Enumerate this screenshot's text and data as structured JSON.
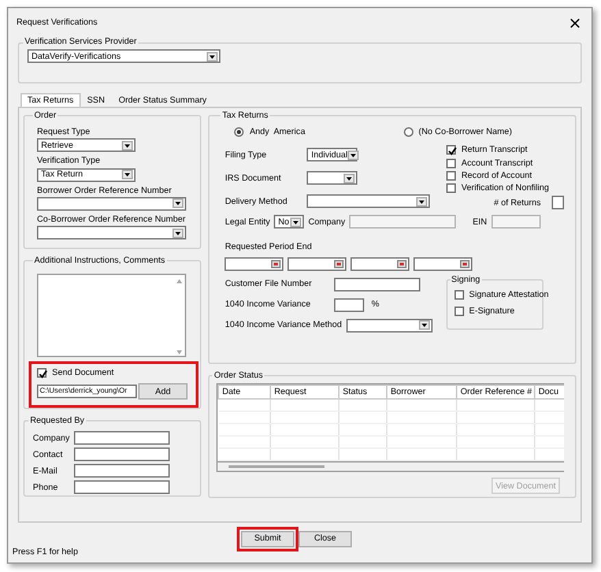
{
  "window": {
    "title": "Request Verifications"
  },
  "provider": {
    "label": "Verification Services Provider",
    "value": "DataVerify-Verifications"
  },
  "tabs": [
    {
      "label": "Tax Returns",
      "selected": true
    },
    {
      "label": "SSN",
      "selected": false
    },
    {
      "label": "Order Status Summary",
      "selected": false
    }
  ],
  "order": {
    "title": "Order",
    "fields": [
      {
        "label": "Request Type",
        "value": "Retrieve"
      },
      {
        "label": "Verification Type",
        "value": "Tax Return"
      },
      {
        "label": "Borrower Order Reference Number"
      },
      {
        "label": "Co-Borrower Order Reference Number"
      }
    ]
  },
  "instructions": {
    "title": "Additional Instructions, Comments",
    "highlighted": true,
    "send_document": {
      "label": "Send Document",
      "checked": true
    },
    "path": "C:\\Users\\derrick_young\\Or",
    "add_button": "Add"
  },
  "requested_by": {
    "title": "Requested By",
    "fields": [
      "Company",
      "Contact",
      "E-Mail",
      "Phone"
    ]
  },
  "tax_returns": {
    "title": "Tax Returns",
    "borrowers": [
      {
        "label": "Andy  America",
        "selected": true
      },
      {
        "label": "(No Co-Borrower Name)",
        "selected": false
      }
    ],
    "filing_type": {
      "label": "Filing Type",
      "value": "Individual"
    },
    "irs_document": {
      "label": "IRS Document"
    },
    "delivery_method": {
      "label": "Delivery Method"
    },
    "options": [
      {
        "label": "Return Transcript",
        "checked": true
      },
      {
        "label": "Account Transcript",
        "checked": false
      },
      {
        "label": "Record of Account",
        "checked": false
      },
      {
        "label": "Verification of Nonfiling",
        "checked": false
      }
    ],
    "returns_count": {
      "label": "# of Returns"
    },
    "legal_entity": {
      "label": "Legal Entity",
      "value": "No"
    },
    "company": {
      "label": "Company"
    },
    "ein": {
      "label": "EIN"
    },
    "period_end": {
      "label": "Requested Period End"
    },
    "customer_file_number": {
      "label": "Customer File Number"
    },
    "income_variance": {
      "label": "1040 Income Variance",
      "unit": "%"
    },
    "variance_method": {
      "label": "1040 Income Variance Method"
    },
    "signing": {
      "title": "Signing",
      "options": [
        {
          "label": "Signature Attestation",
          "checked": false
        },
        {
          "label": "E-Signature",
          "checked": false
        }
      ]
    }
  },
  "order_status": {
    "title": "Order Status",
    "columns": [
      "Date",
      "Request",
      "Status",
      "Borrower",
      "Order Reference #",
      "Docu"
    ],
    "view_button": {
      "label": "View Document",
      "disabled": true
    }
  },
  "buttons": [
    {
      "label": "Submit",
      "highlighted": true
    },
    {
      "label": "Close",
      "highlighted": false
    }
  ],
  "status_text": "Press F1 for help"
}
